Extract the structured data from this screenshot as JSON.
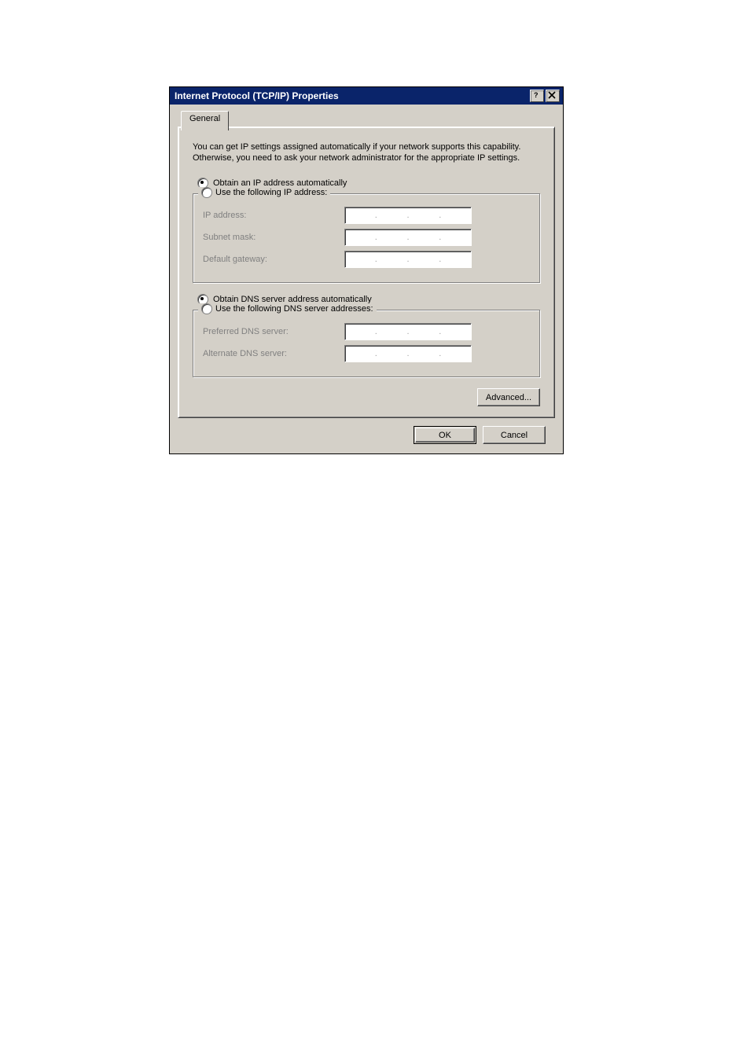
{
  "window": {
    "title": "Internet Protocol (TCP/IP) Properties"
  },
  "tab": {
    "general": "General"
  },
  "description": "You can get IP settings assigned automatically if your network supports this capability. Otherwise, you need to ask your network administrator for the appropriate IP settings.",
  "ip": {
    "auto_label": "Obtain an IP address automatically",
    "manual_label": "Use the following IP address:",
    "auto_selected": true,
    "fields": {
      "ip_address": "IP address:",
      "subnet_mask": "Subnet mask:",
      "default_gateway": "Default gateway:"
    },
    "values": {
      "ip_address": "",
      "subnet_mask": "",
      "default_gateway": ""
    }
  },
  "dns": {
    "auto_label": "Obtain DNS server address automatically",
    "manual_label": "Use the following DNS server addresses:",
    "auto_selected": true,
    "fields": {
      "preferred": "Preferred DNS server:",
      "alternate": "Alternate DNS server:"
    },
    "values": {
      "preferred": "",
      "alternate": ""
    }
  },
  "buttons": {
    "advanced": "Advanced...",
    "ok": "OK",
    "cancel": "Cancel"
  }
}
